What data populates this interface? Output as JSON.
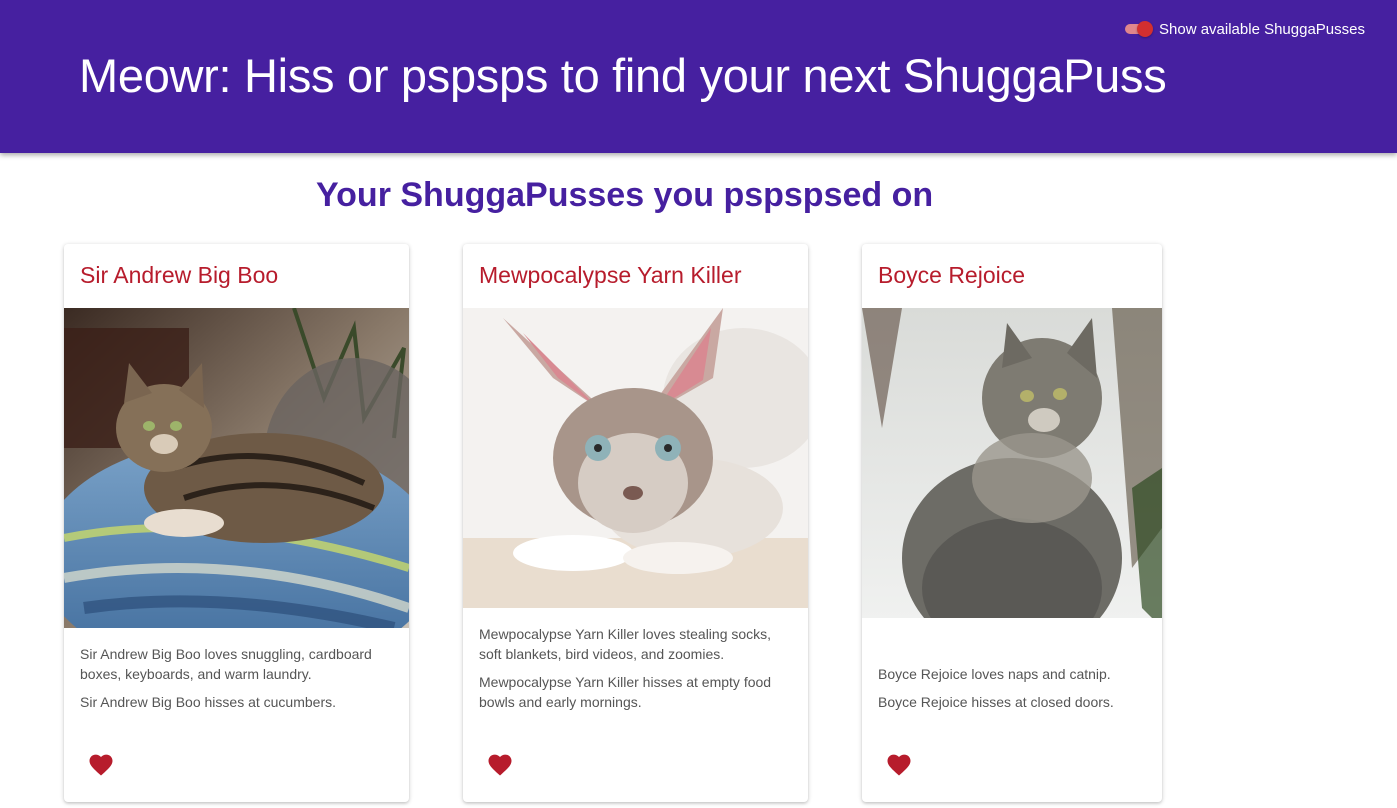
{
  "header": {
    "title": "Meowr: Hiss or pspsps to find your next ShuggaPuss",
    "toggle_label": "Show available ShuggaPusses",
    "toggle_on": true,
    "background_color": "#4620a0"
  },
  "main": {
    "heading": "Your ShuggaPusses you pspspsed on",
    "accent_color": "#b71c2c",
    "cards": [
      {
        "name": "Sir Andrew Big Boo",
        "loves": "Sir Andrew Big Boo loves snuggling, cardboard boxes, keyboards, and warm laundry.",
        "hisses": "Sir Andrew Big Boo hisses at cucumbers.",
        "photo": "tabby-cat-on-striped-cushion",
        "like_icon": "heart-icon"
      },
      {
        "name": "Mewpocalypse Yarn Killer",
        "loves": "Mewpocalypse Yarn Killer loves stealing socks, soft blankets, bird videos, and zoomies.",
        "hisses": "Mewpocalypse Yarn Killer hisses at empty food bowls and early mornings.",
        "photo": "devon-rex-kitten",
        "like_icon": "heart-icon"
      },
      {
        "name": "Boyce Rejoice",
        "loves": "Boyce Rejoice loves naps and catnip.",
        "hisses": "Boyce Rejoice hisses at closed doors.",
        "photo": "fluffy-cat-in-snow",
        "like_icon": "heart-icon"
      }
    ]
  }
}
